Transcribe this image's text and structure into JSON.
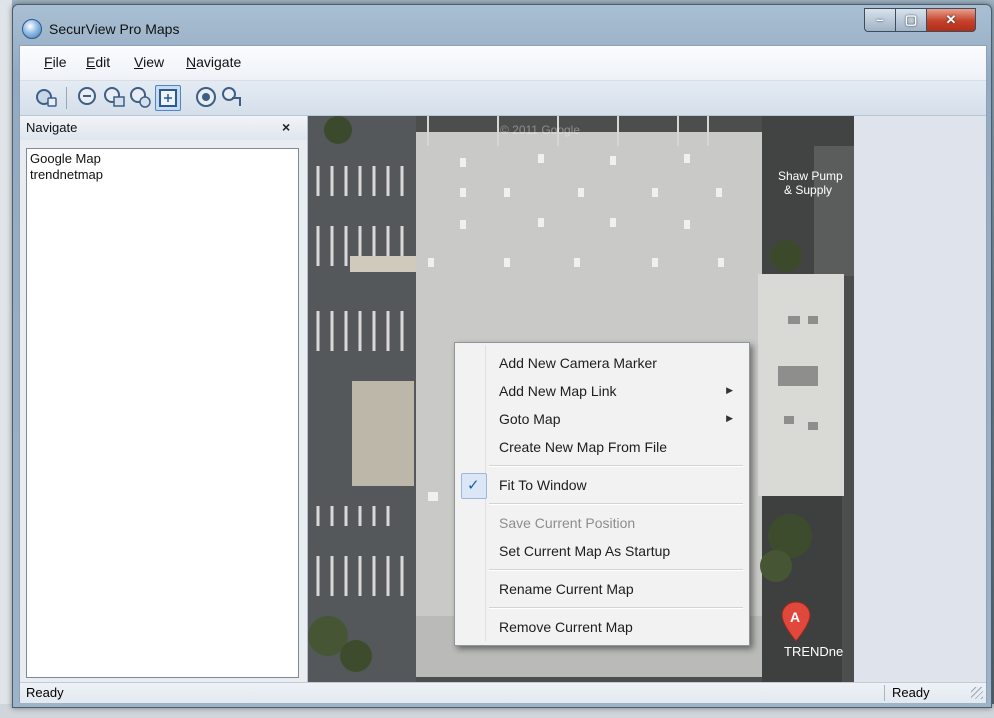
{
  "window": {
    "title": "SecurView Pro Maps",
    "controls": {
      "minimize": "–",
      "maximize": "▢",
      "close": "✕"
    }
  },
  "menubar": {
    "items": [
      {
        "label": "File",
        "accel": "F",
        "rest": "ile"
      },
      {
        "label": "Edit",
        "accel": "E",
        "rest": "dit"
      },
      {
        "label": "View",
        "accel": "V",
        "rest": "iew"
      },
      {
        "label": "Navigate",
        "accel": "N",
        "rest": "avigate"
      }
    ]
  },
  "toolbar": {
    "buttons": [
      "camera-add-icon",
      "zoom-icon",
      "zoom-in-icon",
      "zoom-out-icon",
      "fit-window-icon",
      "target-icon",
      "map-link-icon"
    ],
    "active": "fit-window-icon",
    "accent": "#4f86bf"
  },
  "nav_panel": {
    "title": "Navigate",
    "close_glyph": "×",
    "items": [
      "Google Map",
      "trendnetmap"
    ]
  },
  "map": {
    "watermark": "© 2011 Google",
    "label_top_right": "Shaw Pump & Supply",
    "marker_letter": "A",
    "marker_label": "TRENDne",
    "marker_color": "#e0483c"
  },
  "context_menu": {
    "items": [
      {
        "label": "Add New Camera Marker"
      },
      {
        "label": "Add New Map Link",
        "submenu": "▶"
      },
      {
        "label": "Goto Map",
        "submenu": "▶"
      },
      {
        "label": "Create New Map From File"
      },
      {
        "label": "Fit To Window",
        "checked": "✓"
      },
      {
        "label": "Save Current Position",
        "disabled": true
      },
      {
        "label": "Set Current Map As Startup"
      },
      {
        "label": "Rename Current Map"
      },
      {
        "label": "Remove Current Map"
      }
    ]
  },
  "statusbar": {
    "left": "Ready",
    "right": "Ready"
  }
}
